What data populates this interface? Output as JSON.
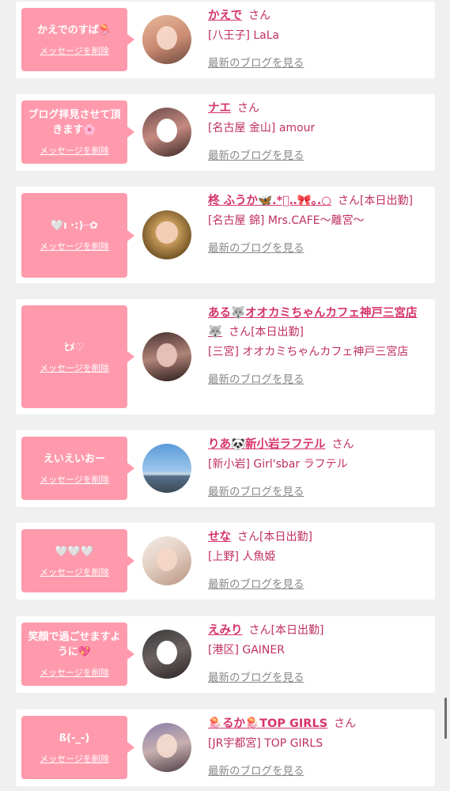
{
  "delete_label": "メッセージを削除",
  "blog_label": "最新のブログを見る",
  "san_label": "さん",
  "colors": {
    "bubble": "#ff9aad",
    "name": "#d6336c",
    "text": "#c0305e",
    "link_gray": "#888888",
    "background": "#f0f0f1"
  },
  "items": [
    {
      "message": "かえでのすば🪼",
      "name": "かえで",
      "suffix": "",
      "shop": "[八王子] LaLa"
    },
    {
      "message": "ブログ拝見させて頂きます🌸",
      "name": "ナエ",
      "suffix": "",
      "shop": "[名古屋 金山] amour"
    },
    {
      "message": "🤍ı ·:)┈✿",
      "name": "柊 ふうか🦋.*ﾟ‥🎀｡.○",
      "suffix": "[本日出勤]",
      "shop": "[名古屋 錦] Mrs.CAFE〜離宮〜"
    },
    {
      "message": "ﾋﾒ♡",
      "name": "ある🐺オオカミちゃんカフェ神戸三宮店🐺",
      "suffix": "[本日出勤]",
      "shop": "[三宮] オオカミちゃんカフェ神戸三宮店"
    },
    {
      "message": "えいえいおー",
      "name": "りあ🐼新小岩ラフテル",
      "suffix": "",
      "shop": "[新小岩] Girl'sbar ラフテル"
    },
    {
      "message": "🤍🤍🤍",
      "name": "せな",
      "suffix": "[本日出勤]",
      "shop": "[上野] 人魚姫"
    },
    {
      "message": "笑顔で過ごせますように💖",
      "name": "えみり",
      "suffix": "[本日出勤]",
      "shop": "[港区] GAINER"
    },
    {
      "message": "ß(-_-)",
      "name": "🪼るか🪼TOP GIRLS",
      "suffix": "",
      "shop": "[JR宇都宮] TOP GIRLS"
    }
  ]
}
